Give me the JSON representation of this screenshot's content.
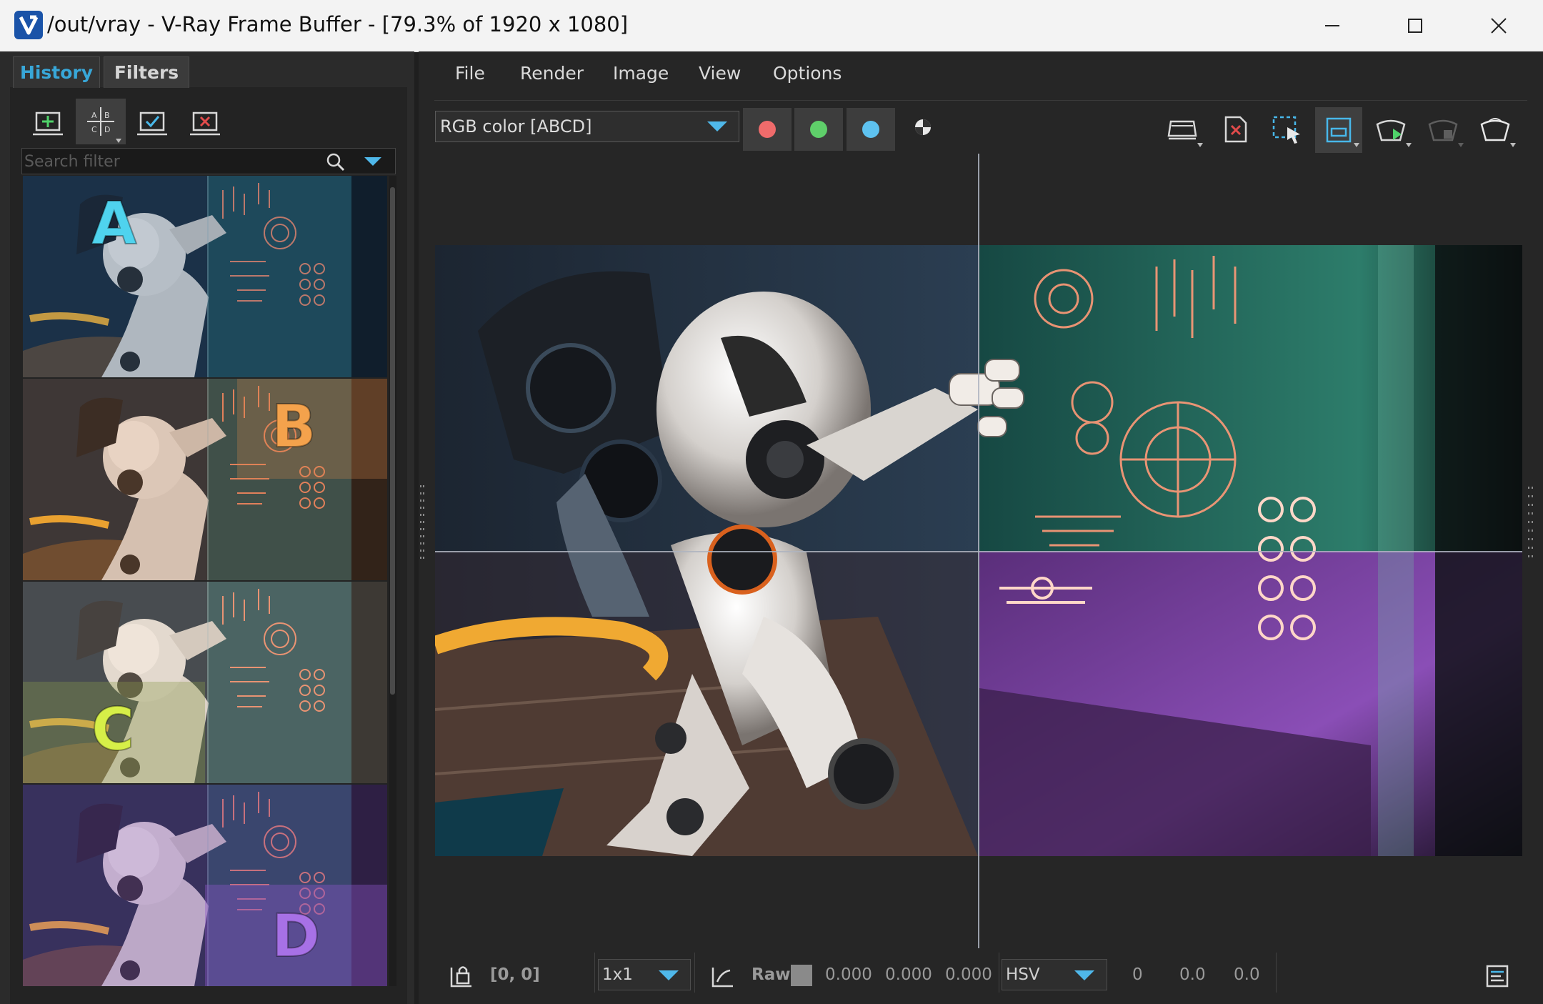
{
  "window": {
    "title": "/out/vray - V-Ray Frame Buffer - [79.3% of 1920 x 1080]",
    "controls": [
      "minimize-icon",
      "maximize-icon",
      "close-icon"
    ]
  },
  "left_panel": {
    "tabs": [
      {
        "label": "History",
        "active": true
      },
      {
        "label": "Filters",
        "active": false
      }
    ],
    "toolbar_icons": [
      "save-to-history-icon",
      "ab-compare-icon",
      "load-history-icon",
      "remove-history-icon"
    ],
    "search": {
      "placeholder": "Search filter",
      "value": ""
    },
    "history_items": [
      {
        "label": "A",
        "label_color": "#4fd3ee"
      },
      {
        "label": "B",
        "label_color": "#f4a24c"
      },
      {
        "label": "C",
        "label_color": "#d6ef48"
      },
      {
        "label": "D",
        "label_color": "#a771e6"
      }
    ]
  },
  "menu": [
    "File",
    "Render",
    "Image",
    "View",
    "Options"
  ],
  "toolbar": {
    "channel": "RGB color [ABCD]",
    "channel_toggles": [
      {
        "name": "red-channel",
        "color": "#ef6b6b"
      },
      {
        "name": "green-channel",
        "color": "#5fcf6a"
      },
      {
        "name": "blue-channel",
        "color": "#5ec2f0"
      }
    ],
    "right_icons": [
      "save-image-icon",
      "clear-image-icon",
      "region-render-icon",
      "track-mouse-icon",
      "start-interactive-icon",
      "stop-render-icon",
      "render-teapot-icon"
    ]
  },
  "status": {
    "coords": "[0, 0]",
    "zoom": "1x1",
    "raw_label": "Raw",
    "raw_values": [
      "0.000",
      "0.000",
      "0.000"
    ],
    "color_mode": "HSV",
    "hsv_values": [
      "0",
      "0.0",
      "0.0"
    ]
  },
  "colors": {
    "accent": "#38a7d8",
    "title_bar": "#f3f3f3",
    "panel_bg": "#2b2b2b",
    "viewport_bg": "#262626"
  }
}
